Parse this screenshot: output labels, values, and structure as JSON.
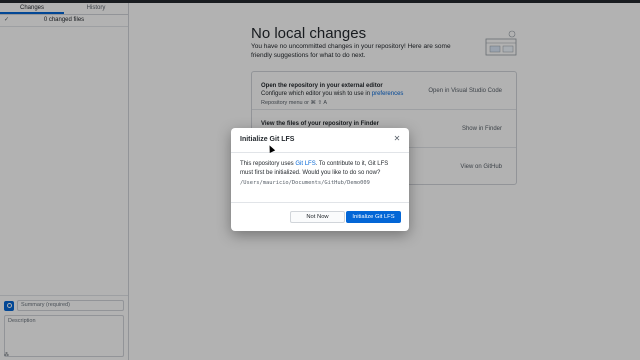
{
  "sidebar": {
    "tabs": [
      {
        "label": "Changes",
        "active": true
      },
      {
        "label": "History",
        "active": false
      }
    ],
    "changes_count_label": "0 changed files",
    "summary_placeholder": "Summary (required)",
    "description_placeholder": "Description"
  },
  "main": {
    "title": "No local changes",
    "subtitle": "You have no uncommitted changes in your repository! Here are some friendly suggestions for what to do next.",
    "suggestions": [
      {
        "title": "Open the repository in your external editor",
        "desc_prefix": "Configure which editor you wish to use in ",
        "desc_link": "preferences",
        "hint": "Repository menu or  ⌘  ⇧  A",
        "action": "Open in Visual Studio Code"
      },
      {
        "title": "View the files of your repository in Finder",
        "action": "Show in Finder"
      },
      {
        "action": "View on GitHub"
      }
    ]
  },
  "dialog": {
    "title": "Initialize Git LFS",
    "body_prefix": "This repository uses ",
    "body_link": "Git LFS",
    "body_suffix": ". To contribute to it, Git LFS must first be initialized. Would you like to do so now?",
    "path": "/Users/mauricio/Documents/GitHub/Demo009",
    "secondary_button": "Not Now",
    "primary_button": "Initialize Git LFS"
  },
  "colors": {
    "accent": "#0366d6",
    "overlay": "rgba(0,0,0,0.30)"
  }
}
